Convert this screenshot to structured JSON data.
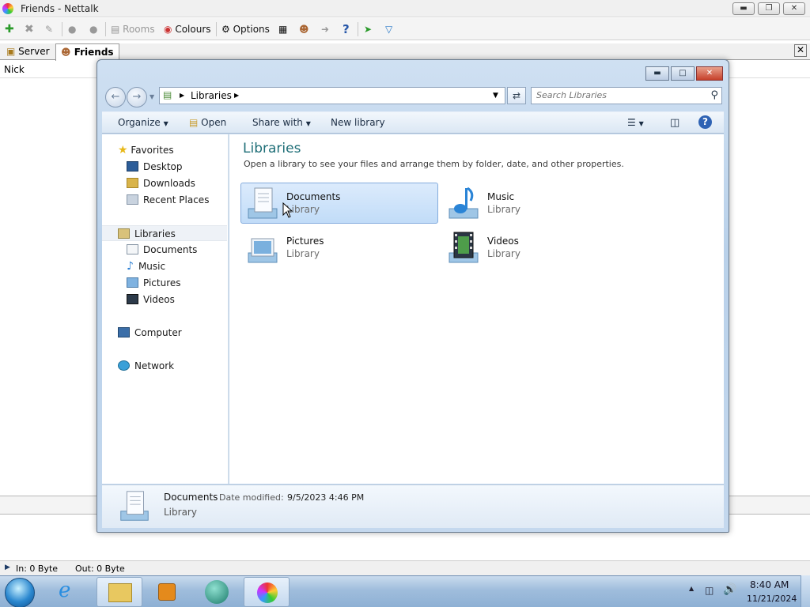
{
  "app": {
    "title": "Friends - Nettalk",
    "toolbar": {
      "rooms_label": "Rooms",
      "colours_label": "Colours",
      "options_label": "Options"
    },
    "tabs": {
      "server_label": "Server",
      "friends_label": "Friends"
    },
    "nick_label": "Nick",
    "status": {
      "in_label": "In: 0 Byte",
      "out_label": "Out: 0 Byte"
    }
  },
  "explorer": {
    "address": {
      "root_label": "Libraries"
    },
    "search_placeholder": "Search Libraries",
    "commands": {
      "organize": "Organize",
      "open": "Open",
      "share_with": "Share with",
      "new_library": "New library"
    },
    "nav": {
      "favorites": "Favorites",
      "desktop": "Desktop",
      "downloads": "Downloads",
      "recent_places": "Recent Places",
      "libraries": "Libraries",
      "documents": "Documents",
      "music": "Music",
      "pictures": "Pictures",
      "videos": "Videos",
      "computer": "Computer",
      "network": "Network"
    },
    "content": {
      "title": "Libraries",
      "subtitle": "Open a library to see your files and arrange them by folder, date, and other properties.",
      "items": [
        {
          "name": "Documents",
          "type": "Library"
        },
        {
          "name": "Music",
          "type": "Library"
        },
        {
          "name": "Pictures",
          "type": "Library"
        },
        {
          "name": "Videos",
          "type": "Library"
        }
      ]
    },
    "details": {
      "name": "Documents",
      "modified_label": "Date modified:",
      "modified_value": "9/5/2023 4:46 PM",
      "type": "Library"
    }
  },
  "taskbar": {
    "time": "8:40 AM",
    "date": "11/21/2024"
  },
  "colors": {
    "title_teal": "#1e6e77",
    "selection_blue": "#c1dcf8",
    "taskbar_blue": "#9fbddc"
  }
}
